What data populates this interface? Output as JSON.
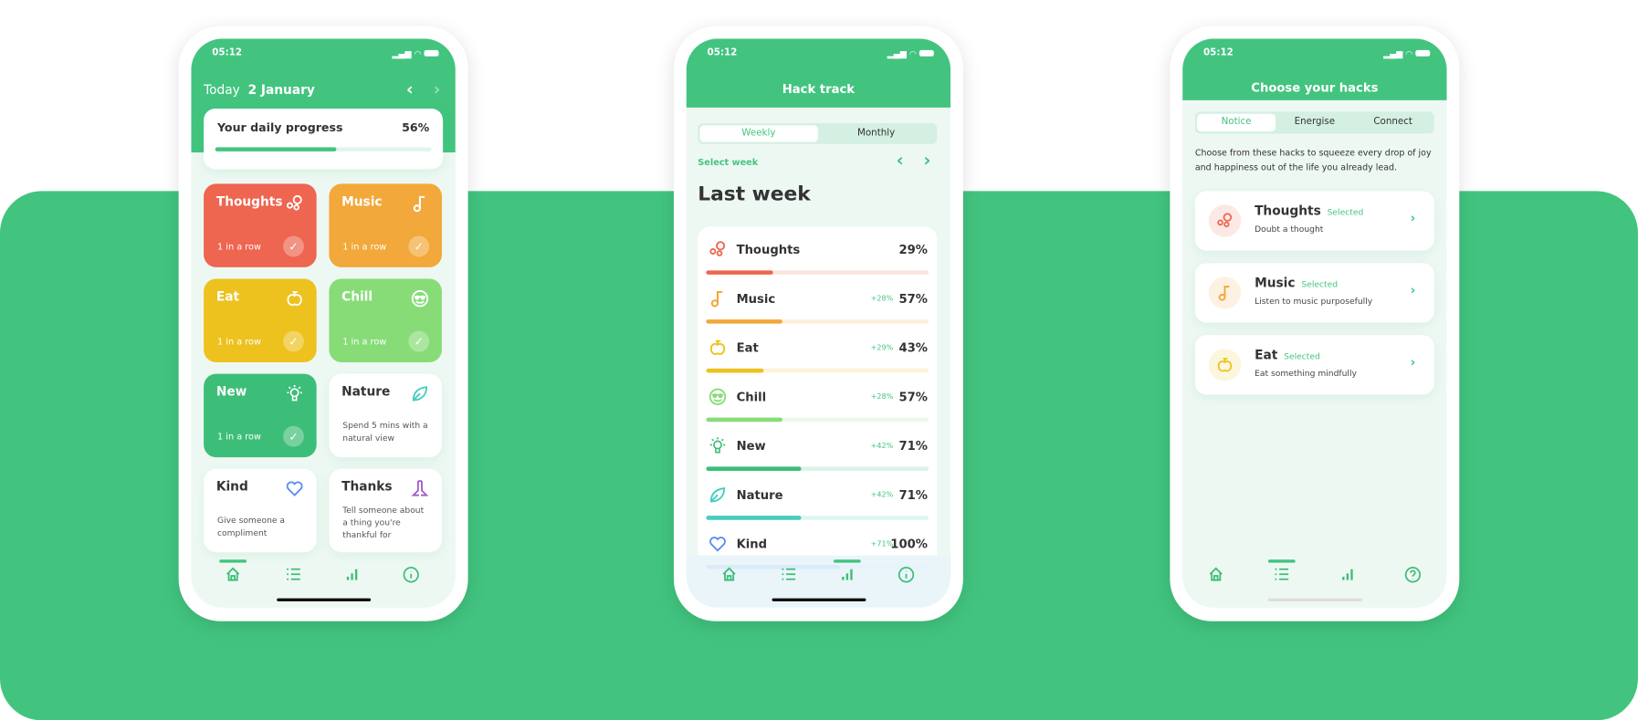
{
  "colors": {
    "brand": "#42C47F",
    "thoughts": "#EE6550",
    "music": "#F2A83A",
    "eat": "#EDC21E",
    "chill": "#87DC78",
    "new": "#3DBE78",
    "nature": "#45CDBF",
    "kind": "#5B8DEF",
    "thanks": "#A05FC9"
  },
  "status_time": "05:12",
  "home": {
    "today": "Today",
    "date": "2 January",
    "progress_label": "Your daily progress",
    "progress_value": "56%",
    "progress_fraction": 0.56,
    "cards": [
      {
        "name": "Thoughts",
        "icon": "thoughts-icon",
        "key": "thoughts",
        "sub": "1 in a row",
        "done": true
      },
      {
        "name": "Music",
        "icon": "music-icon",
        "key": "music",
        "sub": "1 in a row",
        "done": true
      },
      {
        "name": "Eat",
        "icon": "apple-icon",
        "key": "eat",
        "sub": "1 in a row",
        "done": true
      },
      {
        "name": "Chill",
        "icon": "sunglasses-smiley-icon",
        "key": "chill",
        "sub": "1 in a row",
        "done": true
      },
      {
        "name": "New",
        "icon": "lightbulb-icon",
        "key": "new",
        "sub": "1 in a row",
        "done": true
      },
      {
        "name": "Nature",
        "icon": "leaf-icon",
        "key": "nature",
        "desc": "Spend 5 mins with a natural view",
        "done": false
      },
      {
        "name": "Kind",
        "icon": "heart-icon",
        "key": "kind",
        "desc": "Give someone a compliment",
        "done": false
      },
      {
        "name": "Thanks",
        "icon": "praying-hands-icon",
        "key": "thanks",
        "desc": "Tell someone about a thing you're thankful for",
        "done": false
      }
    ],
    "active_tab": "home"
  },
  "track": {
    "title": "Hack track",
    "tabs": [
      "Weekly",
      "Monthly"
    ],
    "active_tab": "Weekly",
    "select_week": "Select week",
    "period": "Last week",
    "rows": [
      {
        "name": "Thoughts",
        "key": "thoughts",
        "delta": "",
        "pct": "29%",
        "value": 29
      },
      {
        "name": "Music",
        "key": "music",
        "delta": "+28%",
        "pct": "57%",
        "value": 57
      },
      {
        "name": "Eat",
        "key": "eat",
        "delta": "+29%",
        "pct": "43%",
        "value": 43
      },
      {
        "name": "Chill",
        "key": "chill",
        "delta": "+28%",
        "pct": "57%",
        "value": 57
      },
      {
        "name": "New",
        "key": "new",
        "delta": "+42%",
        "pct": "71%",
        "value": 71
      },
      {
        "name": "Nature",
        "key": "nature",
        "delta": "+42%",
        "pct": "71%",
        "value": 71
      },
      {
        "name": "Kind",
        "key": "kind",
        "delta": "+71%",
        "pct": "100%",
        "value": 100
      }
    ],
    "active_nav": "stats"
  },
  "hacks": {
    "title": "Choose your hacks",
    "tabs": [
      "Notice",
      "Energise",
      "Connect"
    ],
    "active_tab": "Notice",
    "intro": "Choose from these hacks to squeeze every drop of joy and happiness out of the life you already lead.",
    "items": [
      {
        "name": "Thoughts",
        "key": "thoughts",
        "badge": "Selected",
        "desc": "Doubt a thought"
      },
      {
        "name": "Music",
        "key": "music",
        "badge": "Selected",
        "desc": "Listen to music purposefully"
      },
      {
        "name": "Eat",
        "key": "eat",
        "badge": "Selected",
        "desc": "Eat something mindfully"
      }
    ],
    "active_nav": "list"
  }
}
